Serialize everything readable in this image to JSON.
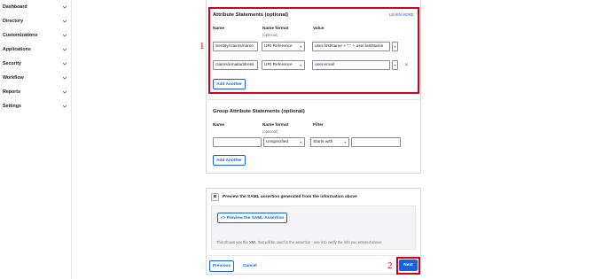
{
  "sidebar": {
    "items": [
      {
        "label": "Dashboard"
      },
      {
        "label": "Directory"
      },
      {
        "label": "Customizations"
      },
      {
        "label": "Applications"
      },
      {
        "label": "Security"
      },
      {
        "label": "Workflow"
      },
      {
        "label": "Reports"
      },
      {
        "label": "Settings"
      }
    ]
  },
  "attribute_statements": {
    "title": "Attribute Statements (optional)",
    "learn_more": "LEARN MORE",
    "col_name": "Name",
    "col_format": "Name format",
    "col_format_sub": "(optional)",
    "col_value": "Value",
    "rows": [
      {
        "name": "Sentity/claims/name",
        "format": "URI Reference",
        "value": "user.firstName + \" \" + user.lastName"
      },
      {
        "name": "claims/emailaddress",
        "format": "URI Reference",
        "value": "user.email"
      }
    ],
    "add_another": "Add Another"
  },
  "group_attribute_statements": {
    "title": "Group Attribute Statements (optional)",
    "col_name": "Name",
    "col_format": "Name format",
    "col_format_sub": "(optional)",
    "col_filter": "Filter",
    "row": {
      "name": "",
      "format": "Unspecified",
      "filter_type": "Starts with",
      "filter_value": ""
    },
    "add_another": "Add Another"
  },
  "preview": {
    "step": "B",
    "title": "Preview the SAML assertion generated from the information above",
    "button": "<> Preview the SAML Assertion",
    "note": "This shows you the XML that will be used in the assertion - use it to verify the info you entered above"
  },
  "footer": {
    "previous": "Previous",
    "cancel": "Cancel",
    "next": "Next"
  },
  "annotations": {
    "one": "1",
    "two": "2",
    "color": "#d0021b"
  },
  "colors": {
    "accent": "#1662dd",
    "highlight": "#d0021b"
  }
}
